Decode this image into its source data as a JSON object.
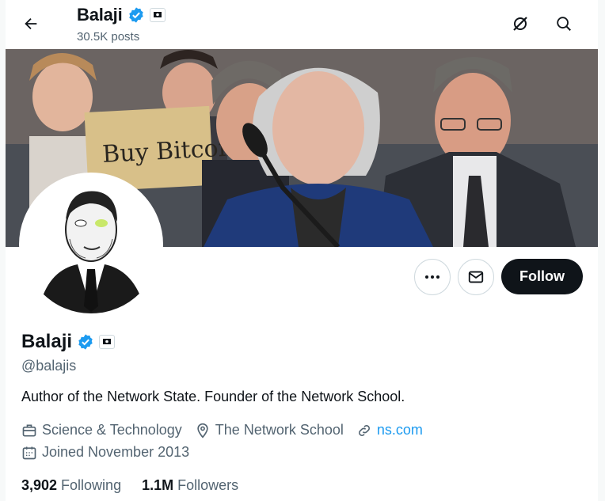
{
  "header": {
    "name": "Balaji",
    "posts": "30.5K posts"
  },
  "banner": {
    "sign_text": "Buy Bitcoin"
  },
  "actions": {
    "more_label": "•••",
    "follow_label": "Follow"
  },
  "profile": {
    "name": "Balaji",
    "handle": "@balajis",
    "bio": "Author of the Network State. Founder of the Network School.",
    "category": "Science & Technology",
    "location": "The Network School",
    "website": "ns.com",
    "joined": "Joined November 2013",
    "following_count": "3,902",
    "following_label": "Following",
    "followers_count": "1.1M",
    "followers_label": "Followers"
  },
  "colors": {
    "verified": "#1d9bf0",
    "link": "#1d9bf0",
    "follow_bg": "#0f1419",
    "secondary_text": "#536471"
  },
  "icons": {
    "back": "arrow-left-icon",
    "grok": "grok-slash-circle-icon",
    "search": "search-icon",
    "verified": "verified-badge-icon",
    "flag": "affiliate-flag-icon",
    "more": "more-dots-icon",
    "message": "envelope-icon",
    "category": "briefcase-icon",
    "location": "location-pin-icon",
    "website": "link-icon",
    "joined": "calendar-icon"
  }
}
